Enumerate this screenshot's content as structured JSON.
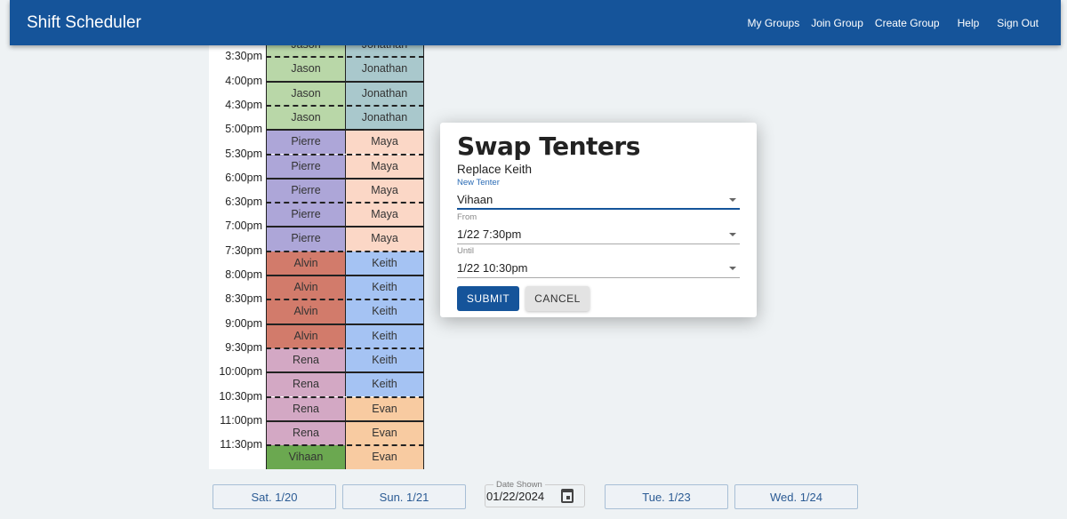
{
  "header": {
    "title": "Shift Scheduler",
    "nav": [
      "My Groups",
      "Join Group",
      "Create Group",
      "Help",
      "Sign Out"
    ]
  },
  "schedule": {
    "times": [
      "3:30pm",
      "4:00pm",
      "4:30pm",
      "5:00pm",
      "5:30pm",
      "6:00pm",
      "6:30pm",
      "7:00pm",
      "7:30pm",
      "8:00pm",
      "8:30pm",
      "9:00pm",
      "9:30pm",
      "10:00pm",
      "10:30pm",
      "11:00pm",
      "11:30pm"
    ],
    "rows": [
      [
        "Jason",
        "Jonathan"
      ],
      [
        "Jason",
        "Jonathan"
      ],
      [
        "Jason",
        "Jonathan"
      ],
      [
        "Jason",
        "Jonathan"
      ],
      [
        "Pierre",
        "Maya"
      ],
      [
        "Pierre",
        "Maya"
      ],
      [
        "Pierre",
        "Maya"
      ],
      [
        "Pierre",
        "Maya"
      ],
      [
        "Pierre",
        "Maya"
      ],
      [
        "Alvin",
        "Keith"
      ],
      [
        "Alvin",
        "Keith"
      ],
      [
        "Alvin",
        "Keith"
      ],
      [
        "Alvin",
        "Keith"
      ],
      [
        "Rena",
        "Keith"
      ],
      [
        "Rena",
        "Keith"
      ],
      [
        "Rena",
        "Evan"
      ],
      [
        "Rena",
        "Evan"
      ],
      [
        "Vihaan",
        "Evan"
      ]
    ],
    "colors": {
      "Jason": "#b9d7a8",
      "Jonathan": "#a9c8cc",
      "Pierre": "#ada6d8",
      "Maya": "#fbd7c6",
      "Alvin": "#d27b6b",
      "Keith": "#a5c3f3",
      "Rena": "#d3a8c4",
      "Evan": "#f8cba1",
      "Vihaan": "#6ba850"
    }
  },
  "dialog": {
    "title": "Swap Tenters",
    "subtitle": "Replace Keith",
    "new_tenter_label": "New Tenter",
    "new_tenter": "Vihaan",
    "from_label": "From",
    "from": "1/22 7:30pm",
    "until_label": "Until",
    "until": "1/22 10:30pm",
    "submit": "SUBMIT",
    "cancel": "CANCEL"
  },
  "footer": {
    "prev2": "Sat. 1/20",
    "prev1": "Sun. 1/21",
    "date_label": "Date Shown",
    "date": "01/22/2024",
    "next1": "Tue. 1/23",
    "next2": "Wed. 1/24"
  }
}
